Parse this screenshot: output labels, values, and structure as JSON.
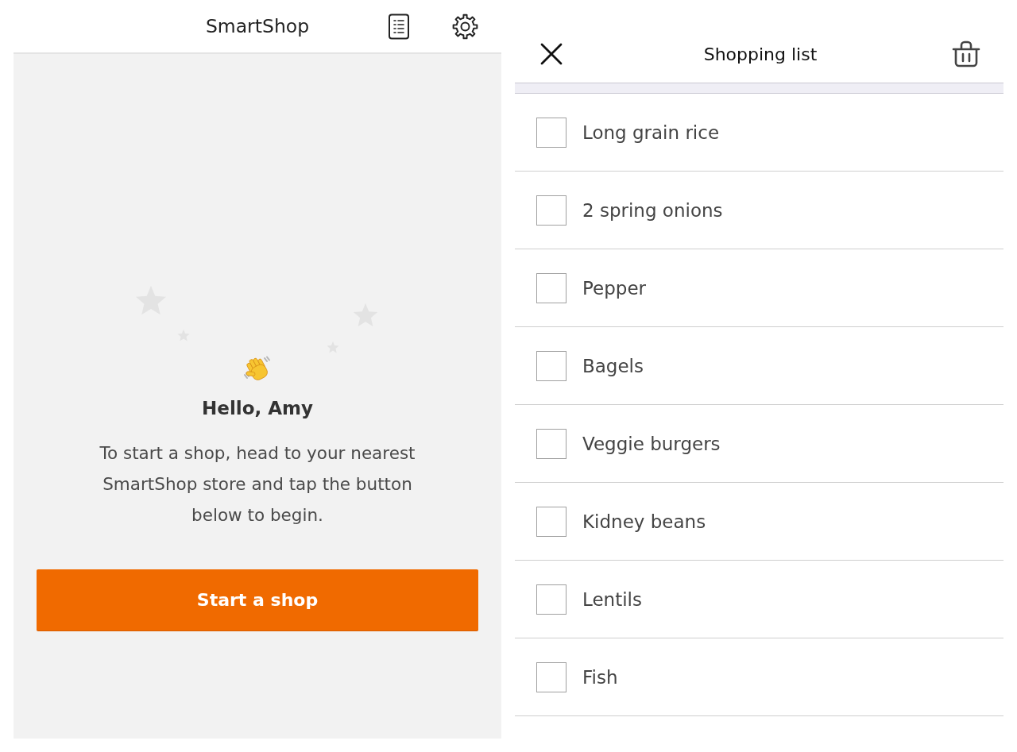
{
  "home": {
    "header": {
      "title": "SmartShop"
    },
    "greeting": "Hello, Amy",
    "message": "To start a shop, head to your nearest SmartShop store and tap the button below to begin.",
    "button": "Start a shop"
  },
  "shopping_list": {
    "title": "Shopping list",
    "items": [
      {
        "label": "Long grain rice",
        "checked": false
      },
      {
        "label": "2 spring onions",
        "checked": false
      },
      {
        "label": "Pepper",
        "checked": false
      },
      {
        "label": "Bagels",
        "checked": false
      },
      {
        "label": "Veggie burgers",
        "checked": false
      },
      {
        "label": "Kidney beans",
        "checked": false
      },
      {
        "label": "Lentils",
        "checked": false
      },
      {
        "label": "Fish",
        "checked": false
      }
    ]
  }
}
